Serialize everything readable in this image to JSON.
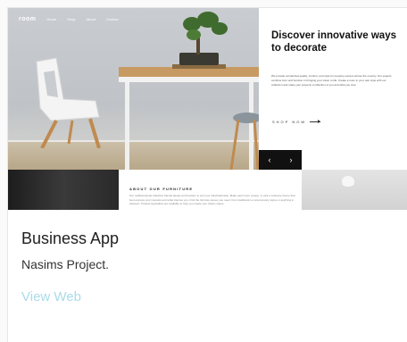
{
  "preview": {
    "nav": {
      "logo": "room",
      "links": [
        "Home",
        "Shop",
        "About",
        "Contact"
      ]
    },
    "headline": "Discover innovative ways to decorate",
    "body_text": "We provide unmatched quality, comfort, and style for property owners across the country. Our experts combine form and function in bringing your vision to life. Create a room in your own style with our collection and make your property a reflection of you and what you love.",
    "shop_label": "SHOP NOW",
    "slider_prev": "‹",
    "slider_next": "›",
    "about_title": "ABOUT OUR FURNITURE",
    "about_text": "Our multifunctional collection blends design and function to suit your individual taste. Make each room unique, or pick a cohesive theme that best express your interests and what inspires you. Find the furniture pieces you need, from traditional to contemporary styles or anything in between. Product specialists are available to help you create your dream space."
  },
  "card": {
    "title": "Business App",
    "subtitle": "Nasims Project.",
    "link_label": "View Web"
  },
  "colors": {
    "link": "#a9dbe9",
    "title": "#1f1f1f"
  }
}
